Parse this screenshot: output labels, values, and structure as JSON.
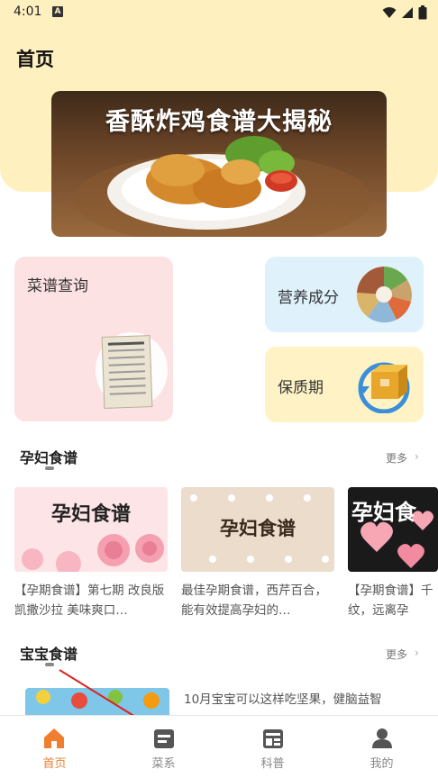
{
  "status_bar": {
    "time": "4:01",
    "notification_badge": "A"
  },
  "header": {
    "title": "首页"
  },
  "banner": {
    "title": "香酥炸鸡食谱大揭秘"
  },
  "cards": {
    "recipe_query": {
      "label": "菜谱查询",
      "color": "#fde2e4"
    },
    "nutrition": {
      "label": "营养成分",
      "color": "#dff1fb"
    },
    "shelf_life": {
      "label": "保质期",
      "color": "#fff3c6"
    }
  },
  "sections": {
    "pregnant": {
      "title": "孕妇食谱",
      "more": "更多",
      "items": [
        {
          "thumb_text": "孕妇食谱",
          "desc": "【孕期食谱】第七期 改良版凯撒沙拉 美味爽口…"
        },
        {
          "thumb_text": "孕妇食谱",
          "desc": "最佳孕期食谱，西芹百合，能有效提高孕妇的…"
        },
        {
          "thumb_text": "孕妇食",
          "desc": "【孕期食谱】千纹，远离孕妈\"逆"
        }
      ]
    },
    "baby": {
      "title": "宝宝食谱",
      "more": "更多",
      "items": [
        {
          "desc": "10月宝宝可以这样吃坚果，健脑益智"
        }
      ]
    }
  },
  "tabbar": {
    "items": [
      {
        "label": "首页",
        "active": true
      },
      {
        "label": "菜系",
        "active": false
      },
      {
        "label": "科普",
        "active": false
      },
      {
        "label": "我的",
        "active": false
      }
    ],
    "active_color": "#f07e2e",
    "inactive_color": "#888888"
  }
}
